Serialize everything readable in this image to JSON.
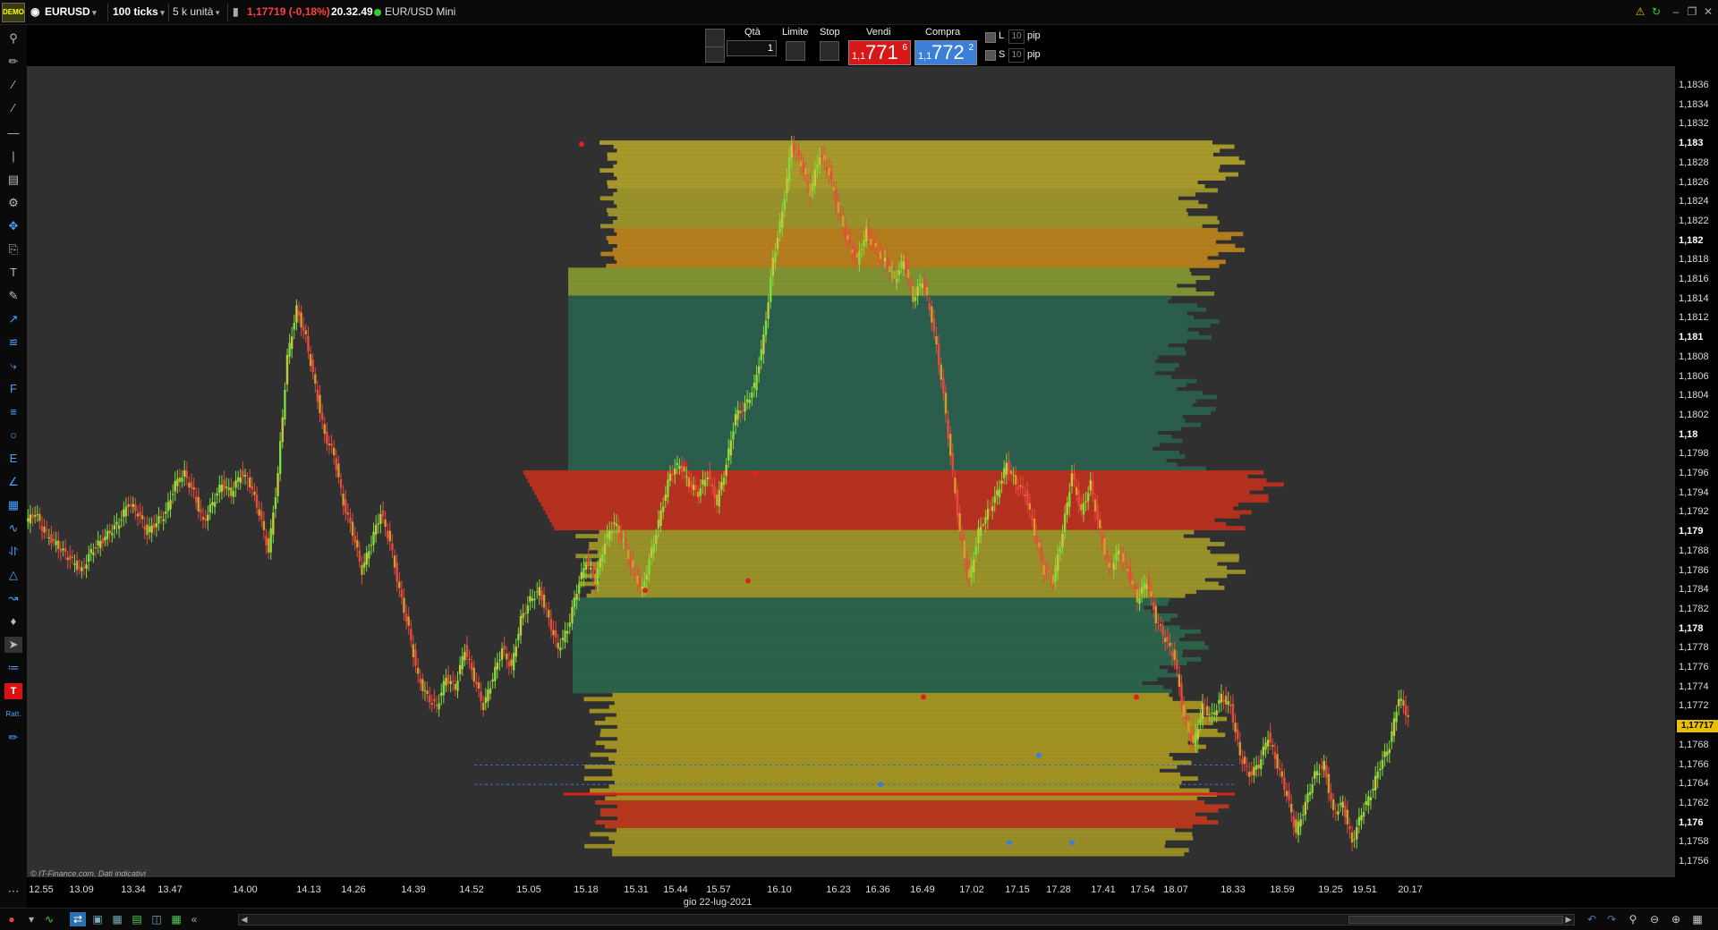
{
  "topbar": {
    "demo_badge": "DEMO",
    "symbol": "EURUSD",
    "ticks": "100 ticks",
    "units": "5 k unità",
    "last_price": "1,17719",
    "change": "(-0,18%)",
    "time": "20.32.49",
    "instrument": "EUR/USD Mini"
  },
  "order_panel": {
    "qty_label": "Qtà",
    "qty_value": "1",
    "limit_label": "Limite",
    "stop_label": "Stop",
    "sell_label": "Vendi",
    "buy_label": "Compra",
    "sell_price_small": "1,1",
    "sell_price_big": "771",
    "sell_price_sup": "6",
    "buy_price_small": "1,1",
    "buy_price_big": "772",
    "buy_price_sup": "2",
    "long_label": "L",
    "short_label": "S",
    "pip_value_long": "10",
    "pip_value_short": "10",
    "pip_unit_long": "pip",
    "pip_unit_short": "pip",
    "sell_color": "#d81818",
    "buy_color": "#3b7fd6"
  },
  "price_axis": {
    "ticks": [
      "1,1836",
      "1,1834",
      "1,1832",
      "1,183",
      "1,1828",
      "1,1826",
      "1,1824",
      "1,1822",
      "1,182",
      "1,1818",
      "1,1816",
      "1,1814",
      "1,1812",
      "1,181",
      "1,1808",
      "1,1806",
      "1,1804",
      "1,1802",
      "1,18",
      "1,1798",
      "1,1796",
      "1,1794",
      "1,1792",
      "1,179",
      "1,1788",
      "1,1786",
      "1,1784",
      "1,1782",
      "1,178",
      "1,1778",
      "1,1776",
      "1,1774",
      "1,1772",
      "1,177",
      "1,1768",
      "1,1766",
      "1,1764",
      "1,1762",
      "1,176",
      "1,1758",
      "1,1756"
    ],
    "last_price_label": "1,17717"
  },
  "time_axis": {
    "ticks": [
      "12.55",
      "13.09",
      "13.34",
      "13.47",
      "14.00",
      "14.13",
      "14.26",
      "14.39",
      "14.52",
      "15.05",
      "15.18",
      "15.31",
      "15.44",
      "15.57",
      "16.10",
      "16.23",
      "16.36",
      "16.49",
      "17.02",
      "17.15",
      "17.28",
      "17.41",
      "17.54",
      "18.07",
      "18.33",
      "18.59",
      "19.25",
      "19.51",
      "20.17"
    ],
    "date": "gio 22-lug-2021"
  },
  "copyright": "© IT-Finance.com. Dati indicativi",
  "chart_data": {
    "type": "candlestick",
    "title": "",
    "x_range": [
      "12.55",
      "20.17"
    ],
    "y_range": [
      1.1755,
      1.1838
    ],
    "grid": false,
    "series": [
      {
        "values": [
          1.1791,
          1.1792,
          1.179,
          1.1789,
          1.1788,
          1.1787,
          1.1786,
          1.1788,
          1.1789,
          1.179,
          1.1791,
          1.1793,
          1.1792,
          1.179,
          1.1791,
          1.1792,
          1.1795,
          1.1796,
          1.1794,
          1.1791,
          1.1793,
          1.1795,
          1.1794,
          1.1796,
          1.1795,
          1.1792,
          1.1788,
          1.1796,
          1.1808,
          1.1813,
          1.181,
          1.1805,
          1.18,
          1.1798,
          1.1793,
          1.179,
          1.1786,
          1.1789,
          1.1792,
          1.1789,
          1.1784,
          1.178,
          1.1775,
          1.1773,
          1.1772,
          1.1775,
          1.1774,
          1.1778,
          1.1775,
          1.1772,
          1.1775,
          1.1778,
          1.1776,
          1.1781,
          1.1783,
          1.1784,
          1.1781,
          1.1778,
          1.178,
          1.1784,
          1.1787,
          1.1785,
          1.1789,
          1.1791,
          1.1789,
          1.1786,
          1.1784,
          1.1788,
          1.1792,
          1.1796,
          1.1797,
          1.1795,
          1.1794,
          1.1796,
          1.1793,
          1.1797,
          1.1802,
          1.1803,
          1.1805,
          1.181,
          1.1818,
          1.1823,
          1.183,
          1.1828,
          1.1825,
          1.1829,
          1.1827,
          1.1823,
          1.182,
          1.1818,
          1.1821,
          1.1819,
          1.1818,
          1.1816,
          1.1818,
          1.1814,
          1.1816,
          1.1812,
          1.1806,
          1.1798,
          1.179,
          1.1785,
          1.179,
          1.1792,
          1.1794,
          1.1797,
          1.1795,
          1.1794,
          1.179,
          1.1786,
          1.1785,
          1.179,
          1.1796,
          1.1792,
          1.1795,
          1.179,
          1.1786,
          1.1788,
          1.1786,
          1.1783,
          1.1785,
          1.1781,
          1.1779,
          1.1777,
          1.1771,
          1.1768,
          1.1772,
          1.1771,
          1.1773,
          1.1772,
          1.1767,
          1.1765,
          1.1766,
          1.1769,
          1.1766,
          1.1763,
          1.1759,
          1.1762,
          1.1765,
          1.1766,
          1.1761,
          1.1762,
          1.1758,
          1.1761,
          1.1763,
          1.1766,
          1.1768,
          1.1773,
          1.1771
        ]
      }
    ],
    "volume_profile": {
      "note_colors": {
        "low": "#1f5a46",
        "mid": "#b4a418",
        "high": "#c8261a"
      }
    }
  }
}
